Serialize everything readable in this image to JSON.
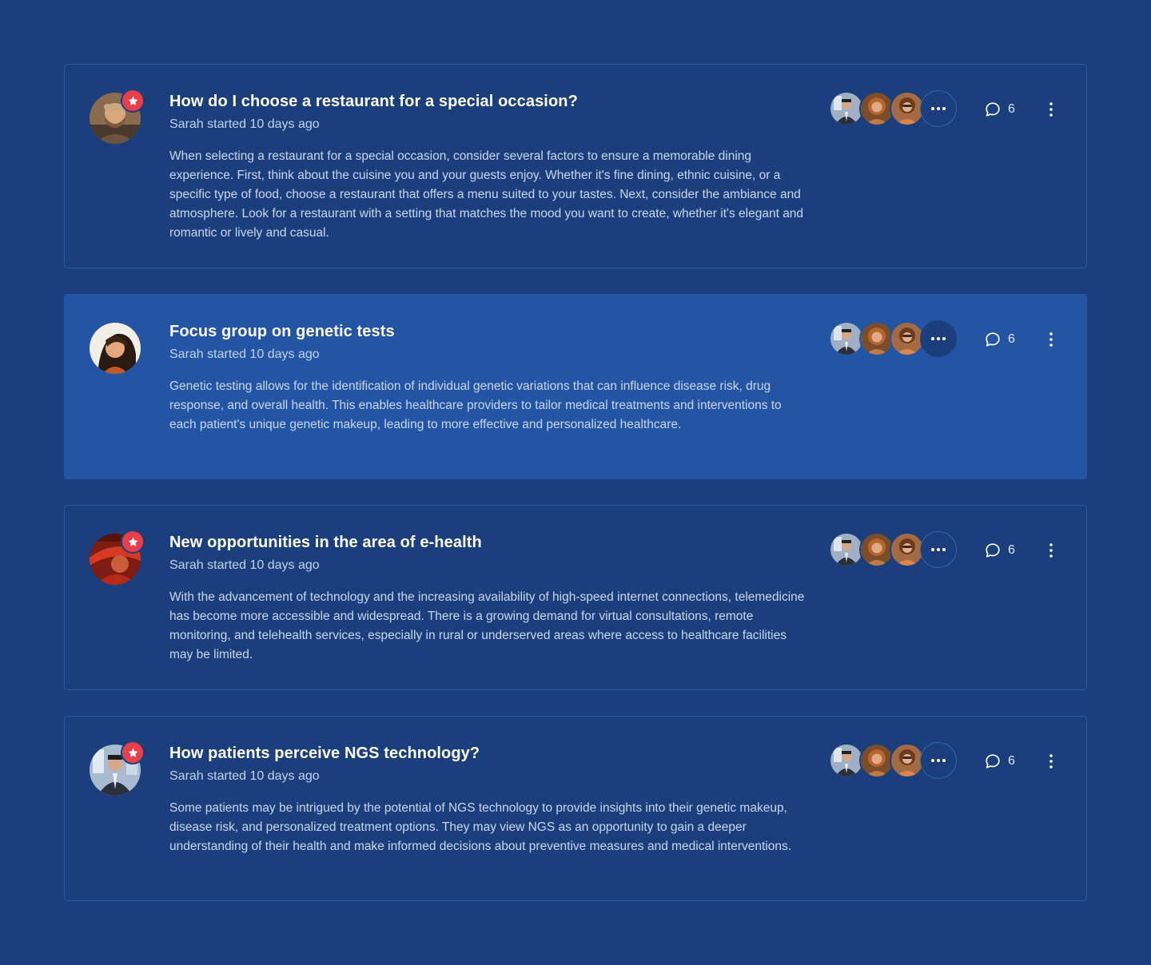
{
  "colors": {
    "background": "#1b3f7d",
    "active_card": "#2455a4",
    "badge": "#e8404a"
  },
  "threads": [
    {
      "title": "How do I choose a restaurant for a special occasion?",
      "meta": "Sarah started 10 days ago",
      "body": "When selecting a restaurant for a special occasion, consider several factors to ensure a memorable dining experience. First, think about the cuisine you and your guests enjoy. Whether it's fine dining, ethnic cuisine, or a specific type of food, choose a restaurant that offers a menu suited to your tastes. Next, consider the ambiance and atmosphere. Look for a restaurant with a setting that matches the mood you want to create, whether it's elegant and romantic or lively and casual.",
      "comment_count": "6",
      "starred": true,
      "active": false,
      "avatar_icon": "man-beard-avatar"
    },
    {
      "title": "Focus group on genetic tests",
      "meta": "Sarah started 10 days ago",
      "body": "Genetic testing allows for the identification of individual genetic variations that can influence disease risk, drug response, and overall health. This enables healthcare providers to tailor medical treatments and interventions to each patient's unique genetic makeup, leading to more effective and personalized healthcare.",
      "comment_count": "6",
      "starred": false,
      "active": true,
      "avatar_icon": "woman-portrait-avatar"
    },
    {
      "title": "New opportunities in the area of e-health",
      "meta": "Sarah started 10 days ago",
      "body": "With the advancement of technology and the increasing availability of high-speed internet connections, telemedicine has become more accessible and widespread. There is a growing demand for virtual consultations, remote monitoring, and telehealth services, especially in rural or underserved areas where access to healthcare facilities may be limited.",
      "comment_count": "6",
      "starred": true,
      "active": false,
      "avatar_icon": "red-hat-avatar"
    },
    {
      "title": "How patients perceive NGS technology?",
      "meta": "Sarah started 10 days ago",
      "body": "Some patients may be intrigued by the potential of NGS technology to provide insights into their genetic makeup, disease risk, and personalized treatment options. They may view NGS as an opportunity to gain a deeper understanding of their health and make informed decisions about preventive measures and medical interventions.",
      "comment_count": "6",
      "starred": true,
      "active": false,
      "avatar_icon": "man-suit-avatar"
    }
  ]
}
